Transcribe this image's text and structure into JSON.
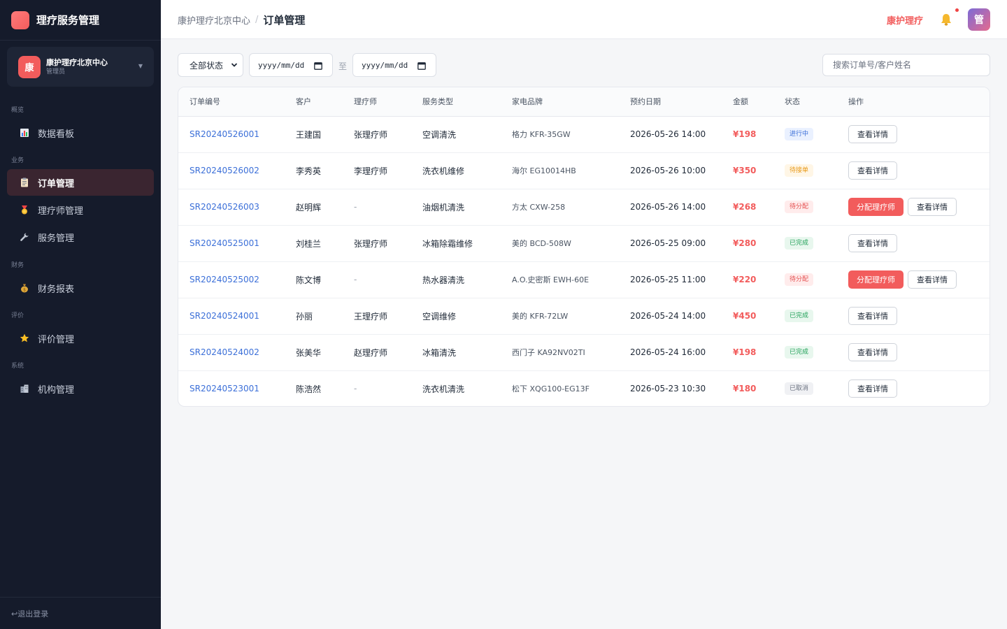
{
  "sidebar": {
    "brand": "理疗服务管理",
    "org": {
      "avatar": "康",
      "name": "康护理疗北京中心",
      "role": "管理员"
    },
    "groups": [
      {
        "label": "概览",
        "items": [
          {
            "label": "数据看板",
            "icon": "chart-icon",
            "active": false
          }
        ]
      },
      {
        "label": "业务",
        "items": [
          {
            "label": "订单管理",
            "icon": "clipboard-icon",
            "active": true
          },
          {
            "label": "理疗师管理",
            "icon": "medal-icon",
            "active": false
          },
          {
            "label": "服务管理",
            "icon": "wrench-icon",
            "active": false
          }
        ]
      },
      {
        "label": "财务",
        "items": [
          {
            "label": "财务报表",
            "icon": "money-bag-icon",
            "active": false
          }
        ]
      },
      {
        "label": "评价",
        "items": [
          {
            "label": "评价管理",
            "icon": "star-icon",
            "active": false
          }
        ]
      },
      {
        "label": "系统",
        "items": [
          {
            "label": "机构管理",
            "icon": "building-icon",
            "active": false
          }
        ]
      }
    ],
    "logout": "↩退出登录"
  },
  "header": {
    "breadcrumb_parent": "康护理疗北京中心",
    "breadcrumb_sep": "/",
    "title": "订单管理",
    "brand": "康护理疗",
    "avatar": "管"
  },
  "filters": {
    "status_value": "全部状态",
    "date_placeholder": "yyyy/mm/dd",
    "date_sep": "至",
    "search_placeholder": "搜索订单号/客户姓名"
  },
  "table": {
    "columns": [
      "订单编号",
      "客户",
      "理疗师",
      "服务类型",
      "家电品牌",
      "预约日期",
      "金额",
      "状态",
      "操作"
    ],
    "rows": [
      {
        "id": "SR20240526001",
        "customer": "王建国",
        "therapist": "张理疗师",
        "service": "空调清洗",
        "brand": "格力 KFR-35GW",
        "date": "2026-05-26 14:00",
        "amount": "¥198",
        "status": "进行中",
        "status_type": "progress",
        "actions": [
          "查看详情"
        ]
      },
      {
        "id": "SR20240526002",
        "customer": "李秀英",
        "therapist": "李理疗师",
        "service": "洗衣机维修",
        "brand": "海尔 EG10014HB",
        "date": "2026-05-26 10:00",
        "amount": "¥350",
        "status": "待接单",
        "status_type": "wait",
        "actions": [
          "查看详情"
        ]
      },
      {
        "id": "SR20240526003",
        "customer": "赵明辉",
        "therapist": "-",
        "service": "油烟机清洗",
        "brand": "方太 CXW-258",
        "date": "2026-05-26 14:00",
        "amount": "¥268",
        "status": "待分配",
        "status_type": "assign",
        "actions": [
          "分配理疗师",
          "查看详情"
        ]
      },
      {
        "id": "SR20240525001",
        "customer": "刘桂兰",
        "therapist": "张理疗师",
        "service": "冰箱除霜维修",
        "brand": "美的 BCD-508W",
        "date": "2026-05-25 09:00",
        "amount": "¥280",
        "status": "已完成",
        "status_type": "done",
        "actions": [
          "查看详情"
        ]
      },
      {
        "id": "SR20240525002",
        "customer": "陈文博",
        "therapist": "-",
        "service": "热水器清洗",
        "brand": "A.O.史密斯 EWH-60E",
        "date": "2026-05-25 11:00",
        "amount": "¥220",
        "status": "待分配",
        "status_type": "assign",
        "actions": [
          "分配理疗师",
          "查看详情"
        ]
      },
      {
        "id": "SR20240524001",
        "customer": "孙丽",
        "therapist": "王理疗师",
        "service": "空调维修",
        "brand": "美的 KFR-72LW",
        "date": "2026-05-24 14:00",
        "amount": "¥450",
        "status": "已完成",
        "status_type": "done",
        "actions": [
          "查看详情"
        ]
      },
      {
        "id": "SR20240524002",
        "customer": "张美华",
        "therapist": "赵理疗师",
        "service": "冰箱清洗",
        "brand": "西门子 KA92NV02TI",
        "date": "2026-05-24 16:00",
        "amount": "¥198",
        "status": "已完成",
        "status_type": "done",
        "actions": [
          "查看详情"
        ]
      },
      {
        "id": "SR20240523001",
        "customer": "陈浩然",
        "therapist": "-",
        "service": "洗衣机清洗",
        "brand": "松下 XQG100-EG13F",
        "date": "2026-05-23 10:30",
        "amount": "¥180",
        "status": "已取消",
        "status_type": "cancel",
        "actions": [
          "查看详情"
        ]
      }
    ]
  },
  "colors": {
    "accent": "#f25c5c",
    "link": "#3b6fd8",
    "sidebar_bg": "#151b2b"
  }
}
